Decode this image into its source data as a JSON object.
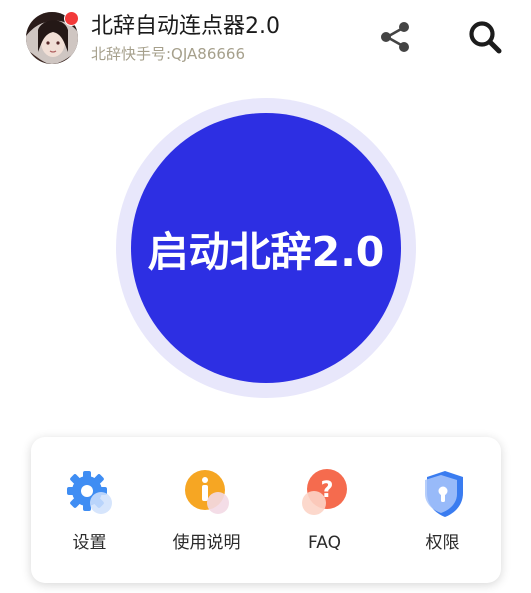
{
  "header": {
    "title": "北辞自动连点器2.0",
    "subtitle": "北辞快手号:QJA86666",
    "icons": {
      "avatar": "avatar-image",
      "notification": "notification-dot",
      "share": "share-icon",
      "search": "search-icon"
    }
  },
  "main": {
    "start_label": "启动北辞2.0"
  },
  "menu": {
    "items": [
      {
        "label": "设置",
        "icon": "gear-icon"
      },
      {
        "label": "使用说明",
        "icon": "info-icon"
      },
      {
        "label": "FAQ",
        "icon": "question-icon"
      },
      {
        "label": "权限",
        "icon": "shield-lock-icon"
      }
    ]
  },
  "colors": {
    "accent": "#2d2fe3",
    "ring": "#e8e7fb",
    "subtitle": "#a6a08c",
    "notification": "#f23a3a"
  }
}
